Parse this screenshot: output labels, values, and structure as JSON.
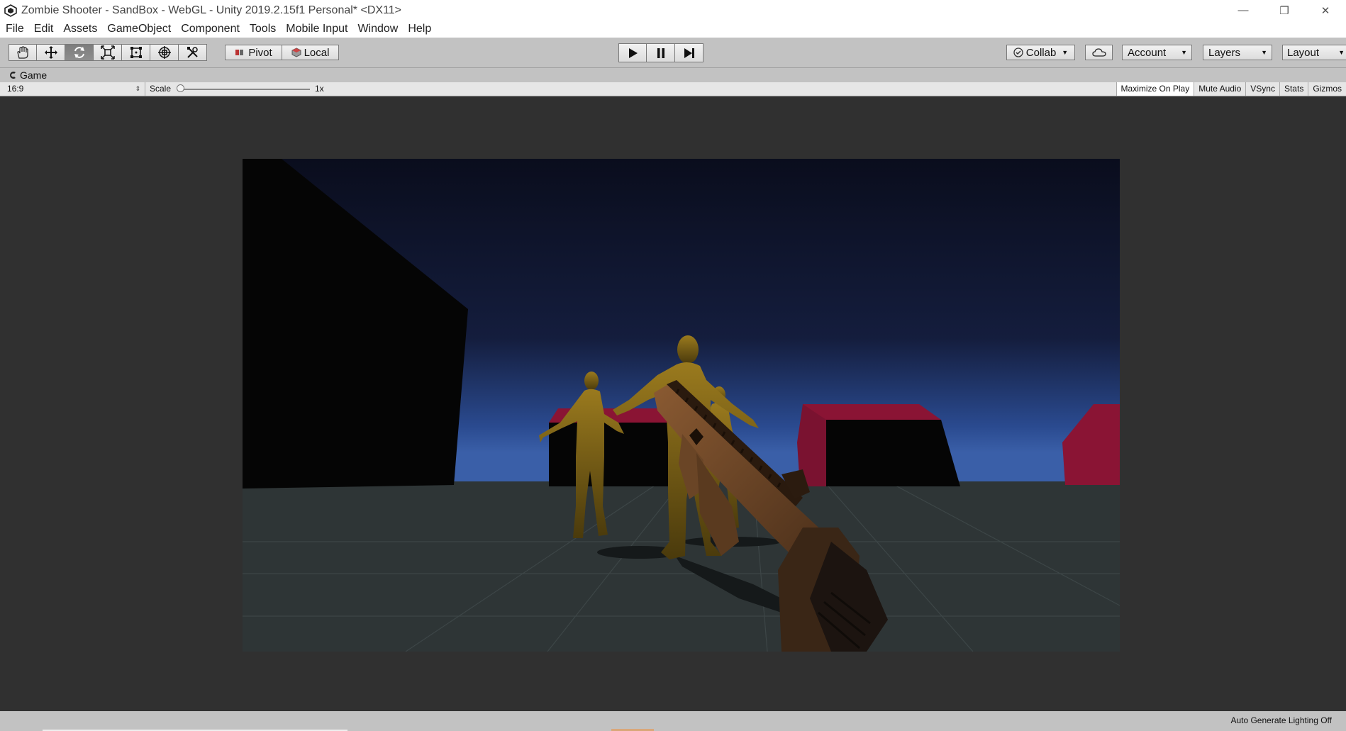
{
  "window": {
    "title": "Zombie Shooter - SandBox - WebGL - Unity 2019.2.15f1 Personal* <DX11>",
    "controls": {
      "minimize": "—",
      "restore": "❐",
      "close": "✕"
    }
  },
  "menu": [
    "File",
    "Edit",
    "Assets",
    "GameObject",
    "Component",
    "Tools",
    "Mobile Input",
    "Window",
    "Help"
  ],
  "toolbar": {
    "tools": [
      "hand-tool",
      "move-tool",
      "rotate-tool",
      "scale-tool",
      "rect-tool",
      "transform-tool",
      "custom-tool"
    ],
    "active_tool": "rotate-tool",
    "pivot_label": "Pivot",
    "local_label": "Local",
    "play_controls": [
      "play",
      "pause",
      "step"
    ],
    "collab_label": "Collab",
    "account_label": "Account",
    "layers_label": "Layers",
    "layout_label": "Layout"
  },
  "game_tab": {
    "label": "Game"
  },
  "game_toolbar": {
    "aspect": "16:9",
    "scale_label": "Scale",
    "scale_value": "1x",
    "scale_level": 0,
    "maximize_on_play": "Maximize On Play",
    "mute_audio": "Mute Audio",
    "vsync": "VSync",
    "stats": "Stats",
    "gizmos": "Gizmos"
  },
  "scene": {
    "sky_top": "#0a0d1d",
    "sky_horizon": "#2a4a8f",
    "ground": "#2e3536",
    "building_red": "#8a1434",
    "zombie_color": "#8a6a16",
    "gun_color": "#6a4526"
  },
  "status": {
    "text": "Auto Generate Lighting Off"
  }
}
